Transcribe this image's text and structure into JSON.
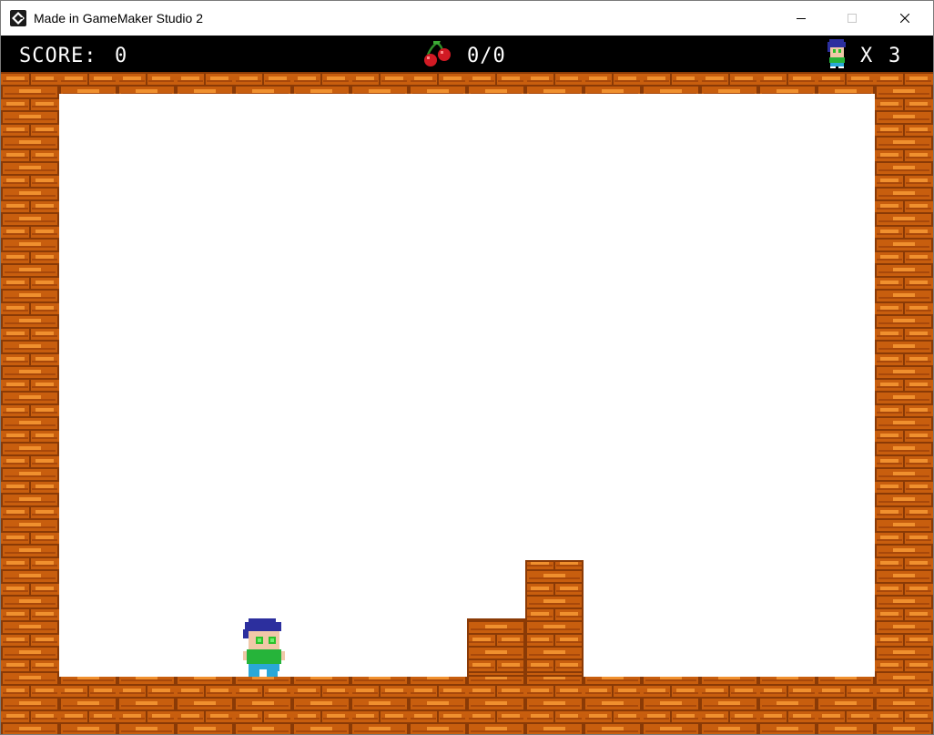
{
  "window": {
    "title": "Made in GameMaker Studio 2",
    "app_icon": "gamemaker-icon",
    "controls": [
      "minimize-icon",
      "maximize-icon",
      "close-icon"
    ]
  },
  "hud": {
    "score_label": "SCORE:",
    "score_value": "0",
    "cherry_icon": "cherry-icon",
    "cherries": "0/0",
    "lives_icon": "player-icon",
    "lives_label": "X",
    "lives_value": "3"
  },
  "colors": {
    "hud_background": "#000000",
    "hud_text": "#ffffff",
    "brick_base": "#c85e0e",
    "brick_highlight": "#f0902e",
    "brick_mortar": "#8a3a06",
    "background": "#ffffff"
  },
  "scene": {
    "player": "player-character",
    "walls": [
      "top-wall",
      "left-wall",
      "right-wall",
      "floor"
    ],
    "platforms": [
      "low-brick-block",
      "tall-brick-block"
    ]
  }
}
